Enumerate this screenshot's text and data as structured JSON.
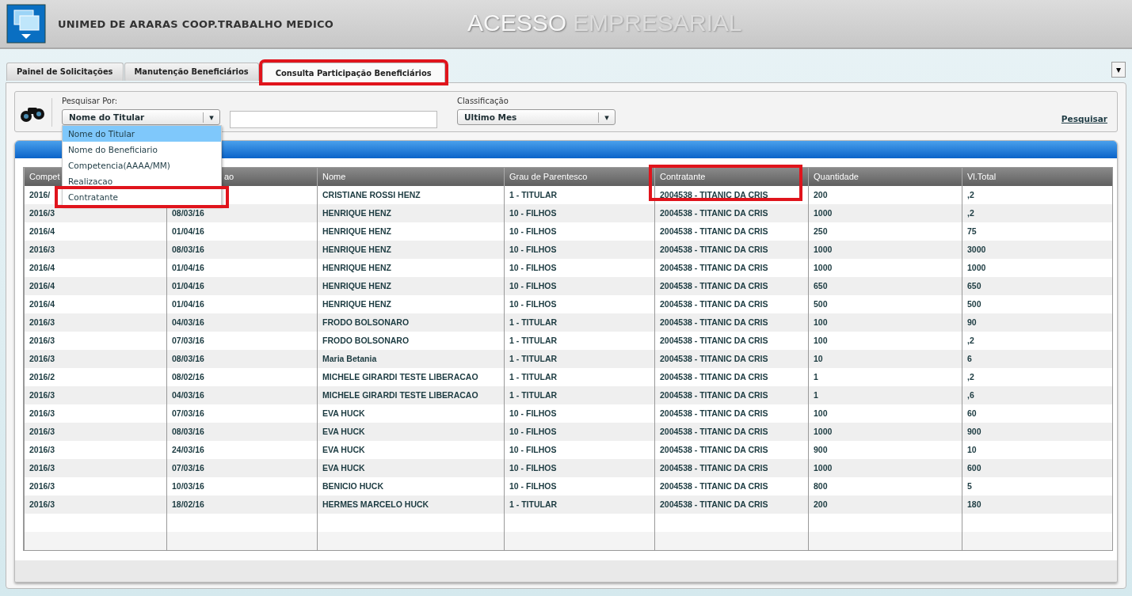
{
  "header": {
    "company": "UNIMED DE ARARAS COOP.TRABALHO MEDICO",
    "title_main": "ACESSO",
    "title_sub": "EMPRESARIAL"
  },
  "tabs": [
    {
      "label": "Painel de Solicitações",
      "selected": false,
      "highlighted": false
    },
    {
      "label": "Manutenção Beneficiários",
      "selected": false,
      "highlighted": false
    },
    {
      "label": "Consulta Participação Beneficiários",
      "selected": true,
      "highlighted": true
    }
  ],
  "tab_menu": {
    "icon": "▾"
  },
  "search": {
    "label": "Pesquisar Por:",
    "value": "Nome do Titular",
    "classificacao_label": "Classificação",
    "classificacao_value": "Ultimo Mes",
    "submit": "Pesquisar",
    "options": [
      {
        "label": "Nome do Titular",
        "selected": true,
        "highlighted": false
      },
      {
        "label": "Nome do Beneficiario",
        "selected": false,
        "highlighted": false
      },
      {
        "label": "Competencia(AAAA/MM)",
        "selected": false,
        "highlighted": false
      },
      {
        "label": "Realizacao",
        "selected": false,
        "highlighted": false
      },
      {
        "label": "Contratante",
        "selected": false,
        "highlighted": true
      }
    ]
  },
  "table": {
    "columns": [
      {
        "label": "Compet",
        "highlighted": false
      },
      {
        "label": "ao",
        "highlighted": false
      },
      {
        "label": "Nome",
        "highlighted": false
      },
      {
        "label": "Grau de Parentesco",
        "highlighted": false
      },
      {
        "label": "Contratante",
        "highlighted": true
      },
      {
        "label": "Quantidade",
        "highlighted": false
      },
      {
        "label": "Vl.Total",
        "highlighted": false
      }
    ],
    "rows": [
      {
        "cells": [
          "2016/",
          null,
          "CRISTIANE ROSSI HENZ",
          "1 - TITULAR",
          "2004538 - TITANIC DA CRIS",
          "200",
          ",2"
        ]
      },
      {
        "cells": [
          "2016/3",
          "08/03/16",
          "HENRIQUE HENZ",
          "10 - FILHOS",
          "2004538 - TITANIC DA CRIS",
          "1000",
          ",2"
        ]
      },
      {
        "cells": [
          "2016/4",
          "01/04/16",
          "HENRIQUE HENZ",
          "10 - FILHOS",
          "2004538 - TITANIC DA CRIS",
          "250",
          "75"
        ]
      },
      {
        "cells": [
          "2016/3",
          "08/03/16",
          "HENRIQUE HENZ",
          "10 - FILHOS",
          "2004538 - TITANIC DA CRIS",
          "1000",
          "3000"
        ]
      },
      {
        "cells": [
          "2016/4",
          "01/04/16",
          "HENRIQUE HENZ",
          "10 - FILHOS",
          "2004538 - TITANIC DA CRIS",
          "1000",
          "1000"
        ]
      },
      {
        "cells": [
          "2016/4",
          "01/04/16",
          "HENRIQUE HENZ",
          "10 - FILHOS",
          "2004538 - TITANIC DA CRIS",
          "650",
          "650"
        ]
      },
      {
        "cells": [
          "2016/4",
          "01/04/16",
          "HENRIQUE HENZ",
          "10 - FILHOS",
          "2004538 - TITANIC DA CRIS",
          "500",
          "500"
        ]
      },
      {
        "cells": [
          "2016/3",
          "04/03/16",
          "FRODO BOLSONARO",
          "1 - TITULAR",
          "2004538 - TITANIC DA CRIS",
          "100",
          "90"
        ]
      },
      {
        "cells": [
          "2016/3",
          "07/03/16",
          "FRODO BOLSONARO",
          "1 - TITULAR",
          "2004538 - TITANIC DA CRIS",
          "100",
          ",2"
        ]
      },
      {
        "cells": [
          "2016/3",
          "08/03/16",
          "Maria Betania",
          "1 - TITULAR",
          "2004538 - TITANIC DA CRIS",
          "10",
          "6"
        ]
      },
      {
        "cells": [
          "2016/2",
          "08/02/16",
          "MICHELE GIRARDI TESTE LIBERACAO",
          "1 - TITULAR",
          "2004538 - TITANIC DA CRIS",
          "1",
          ",2"
        ]
      },
      {
        "cells": [
          "2016/3",
          "04/03/16",
          "MICHELE GIRARDI TESTE LIBERACAO",
          "1 - TITULAR",
          "2004538 - TITANIC DA CRIS",
          "1",
          ",6"
        ]
      },
      {
        "cells": [
          "2016/3",
          "07/03/16",
          "EVA HUCK",
          "10 - FILHOS",
          "2004538 - TITANIC DA CRIS",
          "100",
          "60"
        ]
      },
      {
        "cells": [
          "2016/3",
          "08/03/16",
          "EVA HUCK",
          "10 - FILHOS",
          "2004538 - TITANIC DA CRIS",
          "1000",
          "900"
        ]
      },
      {
        "cells": [
          "2016/3",
          "24/03/16",
          "EVA HUCK",
          "10 - FILHOS",
          "2004538 - TITANIC DA CRIS",
          "900",
          "10"
        ]
      },
      {
        "cells": [
          "2016/3",
          "07/03/16",
          "EVA HUCK",
          "10 - FILHOS",
          "2004538 - TITANIC DA CRIS",
          "1000",
          "600"
        ]
      },
      {
        "cells": [
          "2016/3",
          "10/03/16",
          "BENICIO HUCK",
          "10 - FILHOS",
          "2004538 - TITANIC DA CRIS",
          "800",
          "5"
        ]
      },
      {
        "cells": [
          "2016/3",
          "18/02/16",
          "HERMES MARCELO HUCK",
          "1 - TITULAR",
          "2004538 - TITANIC DA CRIS",
          "200",
          "180"
        ]
      }
    ]
  }
}
